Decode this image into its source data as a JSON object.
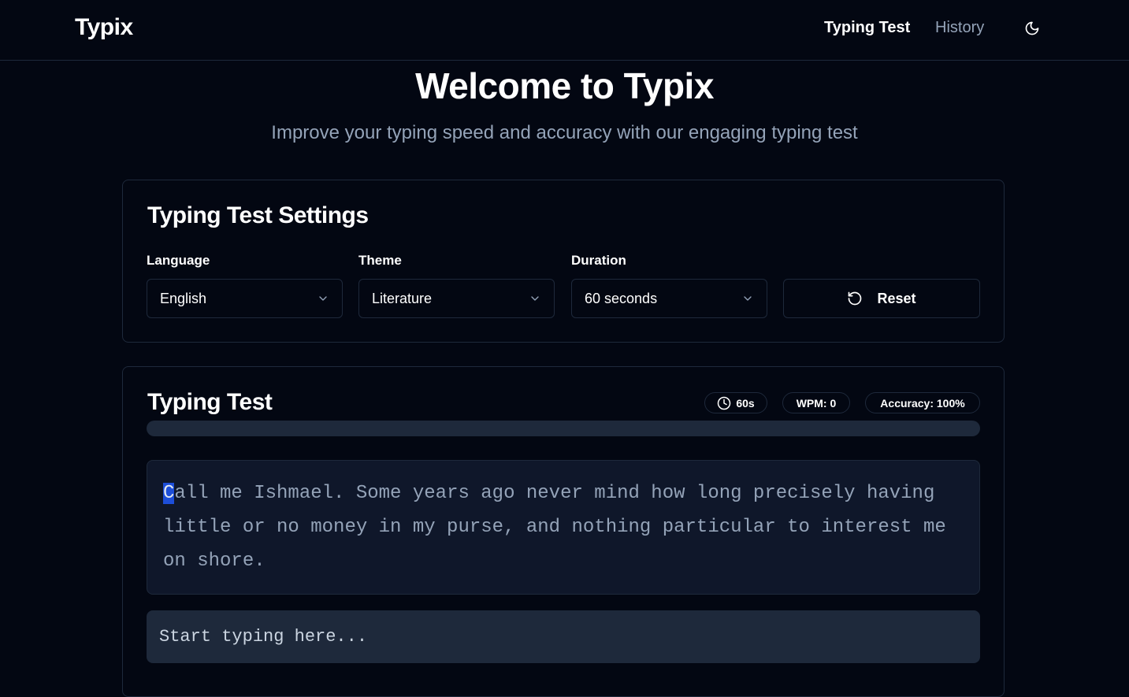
{
  "nav": {
    "brand": "Typix",
    "links": [
      {
        "label": "Typing Test",
        "active": true
      },
      {
        "label": "History",
        "active": false
      }
    ],
    "theme_toggle_icon": "moon-icon"
  },
  "hero": {
    "title": "Welcome to Typix",
    "subtitle": "Improve your typing speed and accuracy with our engaging typing test"
  },
  "settings": {
    "title": "Typing Test Settings",
    "language": {
      "label": "Language",
      "value": "English"
    },
    "theme": {
      "label": "Theme",
      "value": "Literature"
    },
    "duration": {
      "label": "Duration",
      "value": "60 seconds"
    },
    "reset_label": "Reset"
  },
  "test": {
    "title": "Typing Test",
    "timer": "60s",
    "wpm": "WPM: 0",
    "accuracy": "Accuracy: 100%",
    "progress": 0,
    "current_char": "C",
    "remaining_text": "all me Ishmael. Some years ago never mind how long precisely having little or no money in my purse, and nothing particular to interest me on shore.",
    "input_value": "",
    "input_placeholder": "Start typing here..."
  },
  "colors": {
    "background": "#030712",
    "border": "#1e293b",
    "muted_text": "#94a3b8",
    "cursor_highlight": "#1d4ed8"
  }
}
